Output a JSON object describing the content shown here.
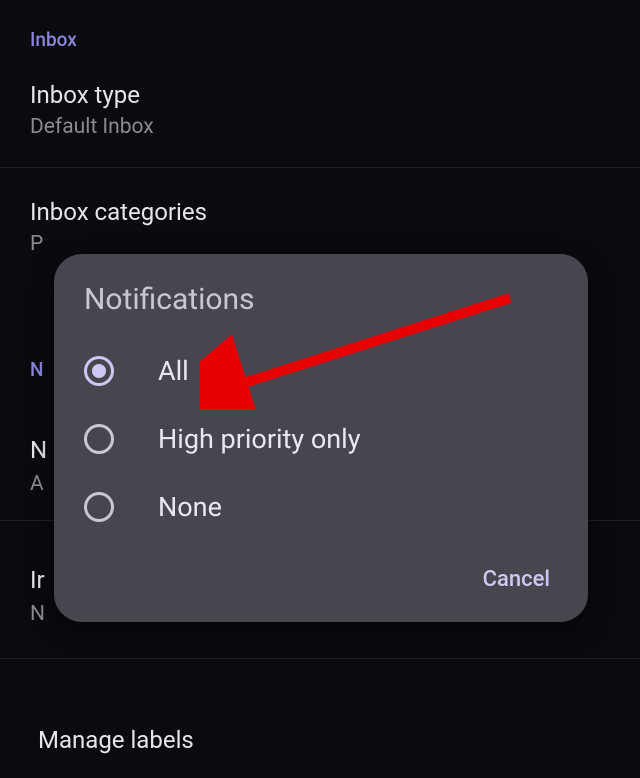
{
  "section_header": "Inbox",
  "settings": {
    "inbox_type": {
      "title": "Inbox type",
      "value": "Default Inbox"
    },
    "inbox_categories": {
      "title": "Inbox categories",
      "value_prefix": "P"
    },
    "manage_labels": {
      "title": "Manage labels"
    }
  },
  "bg": {
    "n_header": "N",
    "n_line": "N",
    "a_line": "A",
    "ir_line": "Ir",
    "n2_line": "N"
  },
  "dialog": {
    "title": "Notifications",
    "options": [
      {
        "label": "All",
        "selected": true
      },
      {
        "label": "High priority only",
        "selected": false
      },
      {
        "label": "None",
        "selected": false
      }
    ],
    "cancel": "Cancel"
  }
}
